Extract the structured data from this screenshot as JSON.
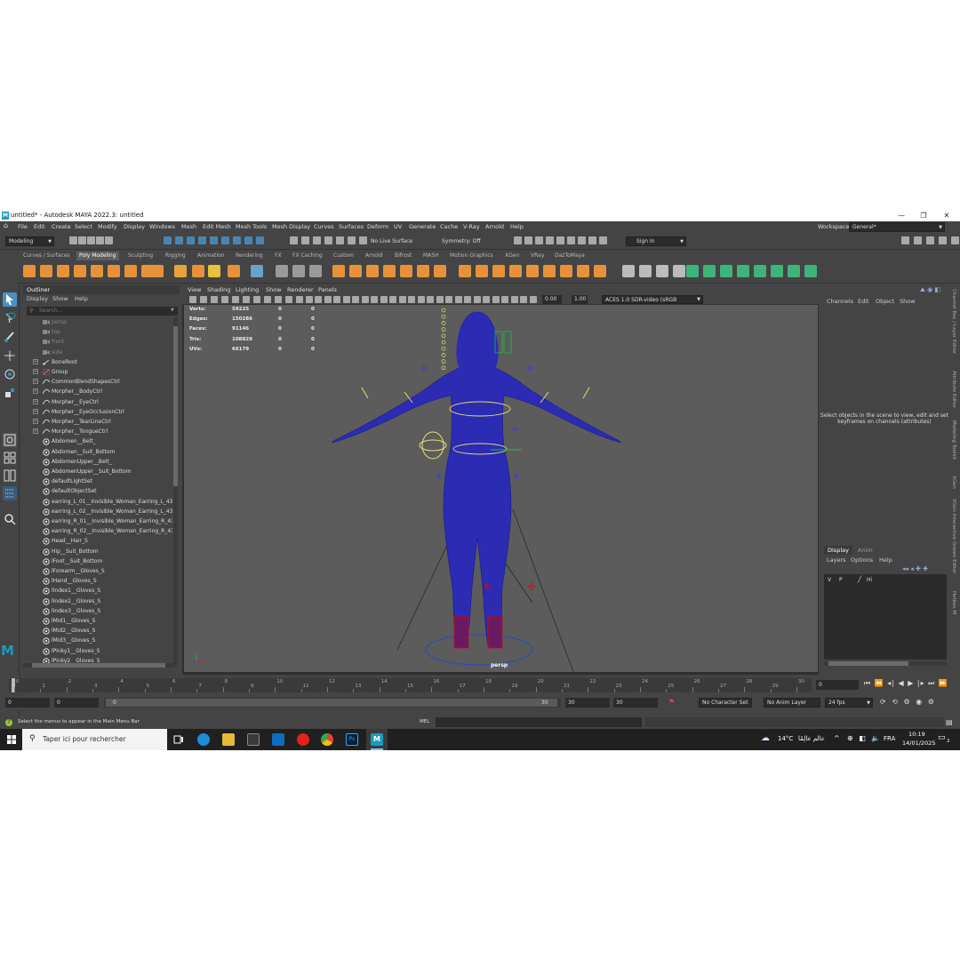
{
  "window": {
    "title": "untitled* - Autodesk MAYA 2022.3: untitled",
    "logo": "M",
    "minimize_icon": "minimize-icon",
    "maximize_icon": "restore-icon",
    "close_icon": "close-icon"
  },
  "menubar": {
    "items": [
      "File",
      "Edit",
      "Create",
      "Select",
      "Modify",
      "Display",
      "Windows",
      "Mesh",
      "Edit Mesh",
      "Mesh Tools",
      "Mesh Display",
      "Curves",
      "Surfaces",
      "Deform",
      "UV",
      "Generate",
      "Cache",
      "V-Ray",
      "Arnold",
      "Help"
    ],
    "workspace_label": "Workspace:",
    "workspace_value": "General*"
  },
  "statusline": {
    "mode": "Modeling",
    "live_surface": "No Live Surface",
    "symmetry": "Symmetry: Off",
    "sign_in": "Sign In"
  },
  "shelf": {
    "tabs": [
      "Curves / Surfaces",
      "Poly Modeling",
      "Sculpting",
      "Rigging",
      "Animation",
      "Rendering",
      "FX",
      "FX Caching",
      "Custom",
      "Arnold",
      "Bifrost",
      "MASH",
      "Motion Graphics",
      "XGen",
      "VRay",
      "DazToMaya"
    ],
    "active_tab": "Poly Modeling"
  },
  "outliner": {
    "title": "Outliner",
    "menu": [
      "Display",
      "Show",
      "Help"
    ],
    "search_placeholder": "Search...",
    "items": [
      {
        "label": "persp",
        "kind": "camera",
        "dim": true,
        "expand": false
      },
      {
        "label": "top",
        "kind": "camera",
        "dim": true,
        "expand": false
      },
      {
        "label": "front",
        "kind": "camera",
        "dim": true,
        "expand": false
      },
      {
        "label": "side",
        "kind": "camera",
        "dim": true,
        "expand": false
      },
      {
        "label": "BoneRoot",
        "kind": "joint",
        "dim": false,
        "expand": true
      },
      {
        "label": "Group",
        "kind": "group",
        "dim": false,
        "expand": true
      },
      {
        "label": "CommonBlendShapesCtrl",
        "kind": "curve",
        "dim": false,
        "expand": true
      },
      {
        "label": "Morpher__BodyCtrl",
        "kind": "curve",
        "dim": false,
        "expand": true
      },
      {
        "label": "Morpher__EyeCtrl",
        "kind": "curve",
        "dim": false,
        "expand": true
      },
      {
        "label": "Morpher__EyeOcclusionCtrl",
        "kind": "curve",
        "dim": false,
        "expand": true
      },
      {
        "label": "Morpher__TearLineCtrl",
        "kind": "curve",
        "dim": false,
        "expand": true
      },
      {
        "label": "Morpher__TongueCtrl",
        "kind": "curve",
        "dim": false,
        "expand": true
      },
      {
        "label": "Abdomen__Belt_",
        "kind": "set",
        "dim": false,
        "expand": false
      },
      {
        "label": "Abdomen__Suit_Bottom",
        "kind": "set",
        "dim": false,
        "expand": false
      },
      {
        "label": "AbdomenUpper__Belt_",
        "kind": "set",
        "dim": false,
        "expand": false
      },
      {
        "label": "AbdomenUpper__Suit_Bottom",
        "kind": "set",
        "dim": false,
        "expand": false
      },
      {
        "label": "defaultLightSet",
        "kind": "set",
        "dim": false,
        "expand": false
      },
      {
        "label": "defaultObjectSet",
        "kind": "set",
        "dim": false,
        "expand": false
      },
      {
        "label": "earring_L_01__Invisible_Woman_Earring_L_432",
        "kind": "set",
        "dim": false,
        "expand": false
      },
      {
        "label": "earring_L_02__Invisible_Woman_Earring_L_432",
        "kind": "set",
        "dim": false,
        "expand": false
      },
      {
        "label": "earring_R_01__Invisible_Woman_Earring_R_432",
        "kind": "set",
        "dim": false,
        "expand": false
      },
      {
        "label": "earring_R_02__Invisible_Woman_Earring_R_432",
        "kind": "set",
        "dim": false,
        "expand": false
      },
      {
        "label": "Head__Hair_S",
        "kind": "set",
        "dim": false,
        "expand": false
      },
      {
        "label": "Hip__Suit_Bottom",
        "kind": "set",
        "dim": false,
        "expand": false
      },
      {
        "label": "lFoot__Suit_Bottom",
        "kind": "set",
        "dim": false,
        "expand": false
      },
      {
        "label": "lForearm__Gloves_S",
        "kind": "set",
        "dim": false,
        "expand": false
      },
      {
        "label": "lHand__Gloves_S",
        "kind": "set",
        "dim": false,
        "expand": false
      },
      {
        "label": "lIndex1__Gloves_S",
        "kind": "set",
        "dim": false,
        "expand": false
      },
      {
        "label": "lIndex2__Gloves_S",
        "kind": "set",
        "dim": false,
        "expand": false
      },
      {
        "label": "lIndex3__Gloves_S",
        "kind": "set",
        "dim": false,
        "expand": false
      },
      {
        "label": "lMid1__Gloves_S",
        "kind": "set",
        "dim": false,
        "expand": false
      },
      {
        "label": "lMid2__Gloves_S",
        "kind": "set",
        "dim": false,
        "expand": false
      },
      {
        "label": "lMid3__Gloves_S",
        "kind": "set",
        "dim": false,
        "expand": false
      },
      {
        "label": "lPinky1__Gloves_S",
        "kind": "set",
        "dim": false,
        "expand": false
      },
      {
        "label": "lPinky2__Gloves_S",
        "kind": "set",
        "dim": false,
        "expand": false
      }
    ]
  },
  "viewport": {
    "menu": [
      "View",
      "Shading",
      "Lighting",
      "Show",
      "Renderer",
      "Panels"
    ],
    "exposure": "0.00",
    "gamma": "1.00",
    "color_space": "ACES 1.0 SDR-video (sRGB",
    "camera_label": "persp",
    "hud": [
      {
        "label": "Verts:",
        "v1": "59225",
        "v2": "0",
        "v3": "0"
      },
      {
        "label": "Edges:",
        "v1": "150286",
        "v2": "0",
        "v3": "0"
      },
      {
        "label": "Faces:",
        "v1": "91146",
        "v2": "0",
        "v3": "0"
      },
      {
        "label": "Tris:",
        "v1": "108829",
        "v2": "0",
        "v3": "0"
      },
      {
        "label": "UVs:",
        "v1": "66179",
        "v2": "0",
        "v3": "0"
      }
    ]
  },
  "channel_box": {
    "menu": [
      "Channels",
      "Edit",
      "Object",
      "Show"
    ],
    "hint": "Select objects in the scene to view, edit and set keyframes on channels (attributes)"
  },
  "layer_editor": {
    "tabs": [
      "Display",
      "Anim"
    ],
    "menu": [
      "Layers",
      "Options",
      "Help"
    ],
    "layer": {
      "v": "V",
      "p": "P",
      "name": "Hi"
    }
  },
  "side_tabs": [
    "Channel Box / Layer Editor",
    "Attribute Editor",
    "Modeling Toolkit",
    "XGen",
    "XGen Interactive Groom Editor",
    "Hotbox M"
  ],
  "timeline": {
    "ticks": [
      "0",
      "2",
      "4",
      "6",
      "8",
      "10",
      "12",
      "14",
      "16",
      "18",
      "20",
      "22",
      "24",
      "26",
      "28",
      "30"
    ],
    "ticks_odd": [
      "1",
      "3",
      "5",
      "7",
      "9",
      "11",
      "13",
      "15",
      "17",
      "19",
      "21",
      "23",
      "25",
      "27",
      "29"
    ],
    "current_frame": "0"
  },
  "range": {
    "start": "0",
    "anim_start": "0",
    "slider_start": "0",
    "slider_end": "30",
    "end": "30",
    "anim_end": "30",
    "character_set": "No Character Set",
    "anim_layer": "No Anim Layer",
    "fps": "24 fps"
  },
  "helpline": {
    "text": "Select the menus to appear in the Main Menu Bar",
    "mel": "MEL"
  },
  "taskbar": {
    "search_placeholder": "Taper ici pour rechercher",
    "weather": "14°C",
    "weather_text": "عالم عالِمًا",
    "language": "FRA",
    "time": "10:19",
    "date": "14/01/2025",
    "notifications": "2"
  },
  "colors": {
    "panel": "#444444",
    "viewport_bg": "#5c5c5c",
    "mesh": "#1c1c9c",
    "accent": "#1b9bbb",
    "shelf_orange": "#e8913b"
  }
}
